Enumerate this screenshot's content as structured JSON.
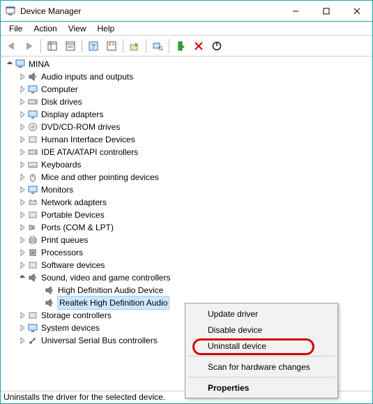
{
  "window": {
    "title": "Device Manager"
  },
  "menu": {
    "file": "File",
    "action": "Action",
    "view": "View",
    "help": "Help"
  },
  "tree": {
    "root": "MINA",
    "items": [
      "Audio inputs and outputs",
      "Computer",
      "Disk drives",
      "Display adapters",
      "DVD/CD-ROM drives",
      "Human Interface Devices",
      "IDE ATA/ATAPI controllers",
      "Keyboards",
      "Mice and other pointing devices",
      "Monitors",
      "Network adapters",
      "Portable Devices",
      "Ports (COM & LPT)",
      "Print queues",
      "Processors",
      "Software devices",
      "Sound, video and game controllers",
      "Storage controllers",
      "System devices",
      "Universal Serial Bus controllers"
    ],
    "sound_children": [
      "High Definition Audio Device",
      "Realtek High Definition Audio"
    ]
  },
  "context_menu": {
    "update": "Update driver",
    "disable": "Disable device",
    "uninstall": "Uninstall device",
    "scan": "Scan for hardware changes",
    "properties": "Properties"
  },
  "status": "Uninstalls the driver for the selected device."
}
